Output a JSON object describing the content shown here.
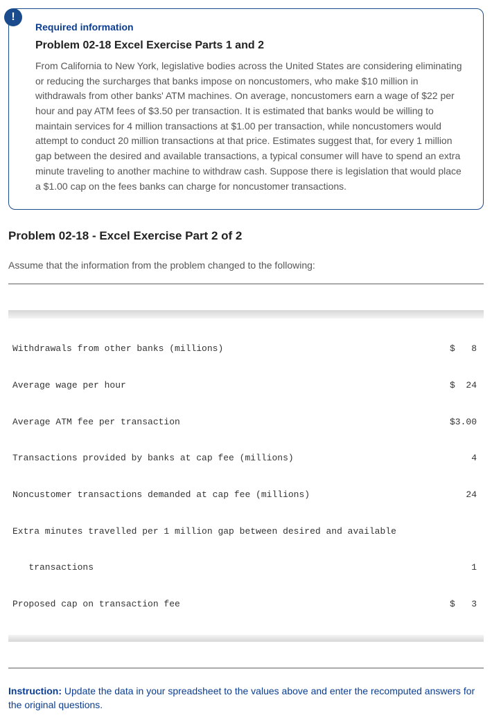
{
  "badge": "!",
  "req": {
    "label": "Required information",
    "title": "Problem 02-18 Excel Exercise Parts 1 and 2",
    "body": "From California to New York, legislative bodies across the United States are considering eliminating or reducing the surcharges that banks impose on noncustomers, who make $10 million in withdrawals from other banks' ATM machines. On average, noncustomers earn a wage of $22 per hour and pay ATM fees of $3.50 per transaction. It is estimated that banks would be willing to maintain services for 4 million transactions at $1.00 per transaction, while noncustomers would attempt to conduct 20 million transactions at that price. Estimates suggest that, for every 1 million gap between the desired and available transactions, a typical consumer will have to spend an extra minute traveling to another machine to withdraw cash. Suppose there is legislation that would place a $1.00 cap on the fees banks can charge for noncustomer transactions."
  },
  "section_heading": "Problem 02-18 - Excel Exercise Part 2 of 2",
  "assume_text": "Assume that the information from the problem changed to the following:",
  "rows": [
    {
      "label": "Withdrawals from other banks (millions)",
      "value": "$   8"
    },
    {
      "label": "Average wage per hour",
      "value": "$  24"
    },
    {
      "label": "Average ATM fee per transaction",
      "value": "$3.00"
    },
    {
      "label": "Transactions provided by banks at cap fee (millions)",
      "value": "4"
    },
    {
      "label": "Noncustomer transactions demanded at cap fee (millions)",
      "value": "24"
    },
    {
      "label": "Extra minutes travelled per 1 million gap between desired and available",
      "value": ""
    },
    {
      "label": "   transactions",
      "value": "1"
    },
    {
      "label": "Proposed cap on transaction fee",
      "value": "$   3"
    }
  ],
  "instruction": {
    "lead": "Instruction:",
    "text": " Update the data in your spreadsheet to the values above and enter the recomputed answers for the original questions."
  },
  "chart_data": {
    "type": "table",
    "title": "Updated problem parameters",
    "rows": [
      {
        "parameter": "Withdrawals from other banks (millions)",
        "value": 8,
        "unit": "$"
      },
      {
        "parameter": "Average wage per hour",
        "value": 24,
        "unit": "$"
      },
      {
        "parameter": "Average ATM fee per transaction",
        "value": 3.0,
        "unit": "$"
      },
      {
        "parameter": "Transactions provided by banks at cap fee (millions)",
        "value": 4,
        "unit": ""
      },
      {
        "parameter": "Noncustomer transactions demanded at cap fee (millions)",
        "value": 24,
        "unit": ""
      },
      {
        "parameter": "Extra minutes travelled per 1 million gap between desired and available transactions",
        "value": 1,
        "unit": ""
      },
      {
        "parameter": "Proposed cap on transaction fee",
        "value": 3,
        "unit": "$"
      }
    ]
  }
}
